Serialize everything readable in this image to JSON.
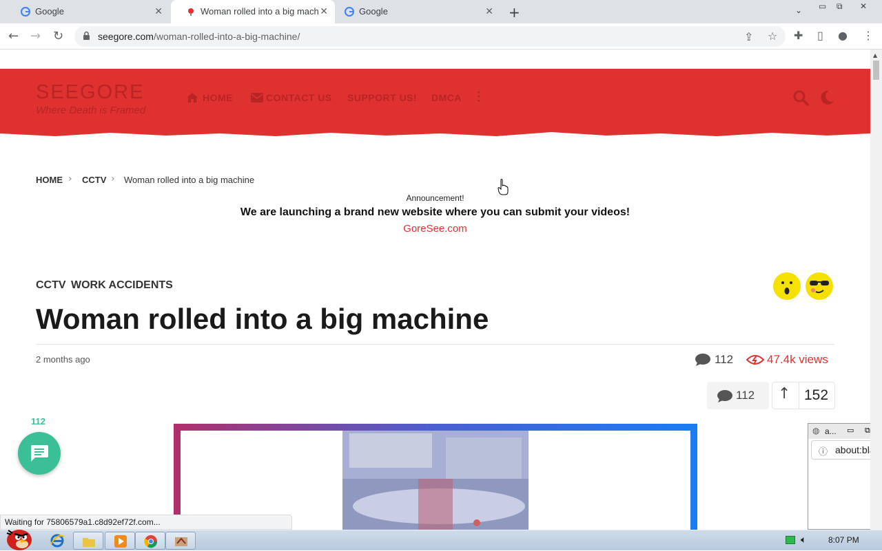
{
  "browser": {
    "tabs": [
      {
        "title": "Google",
        "active": false
      },
      {
        "title": "Woman rolled into a big mach",
        "active": true
      },
      {
        "title": "Google",
        "active": false
      }
    ],
    "new_tab": "+",
    "url_host": "seegore.com",
    "url_path": "/woman-rolled-into-a-big-machine/",
    "status_text": "Waiting for 75806579a1.c8d92ef72f.com..."
  },
  "site": {
    "logo_name": "SEEGORE",
    "logo_tagline": "Where Death is Framed",
    "nav": {
      "home": "HOME",
      "contact": "CONTACT US",
      "support": "SUPPORT US!",
      "dmca": "DMCA"
    },
    "accent": "#e03131"
  },
  "breadcrumb": {
    "home": "HOME",
    "category": "CCTV",
    "current": "Woman rolled into a big machine"
  },
  "announcement": {
    "label": "Announcement!",
    "text": "We are launching a brand new website where you can submit your videos!",
    "link": "GoreSee.com"
  },
  "article": {
    "categories": [
      "CCTV",
      "WORK ACCIDENTS"
    ],
    "title": "Woman rolled into a big machine",
    "posted": "2 months ago",
    "comments": "112",
    "views": "47.4k views",
    "vote_comments": "112",
    "upvotes": "152"
  },
  "fab": {
    "count": "112"
  },
  "popup": {
    "title": "a...",
    "address": "about:blank"
  },
  "taskbar": {
    "clock": "8:07 PM"
  }
}
